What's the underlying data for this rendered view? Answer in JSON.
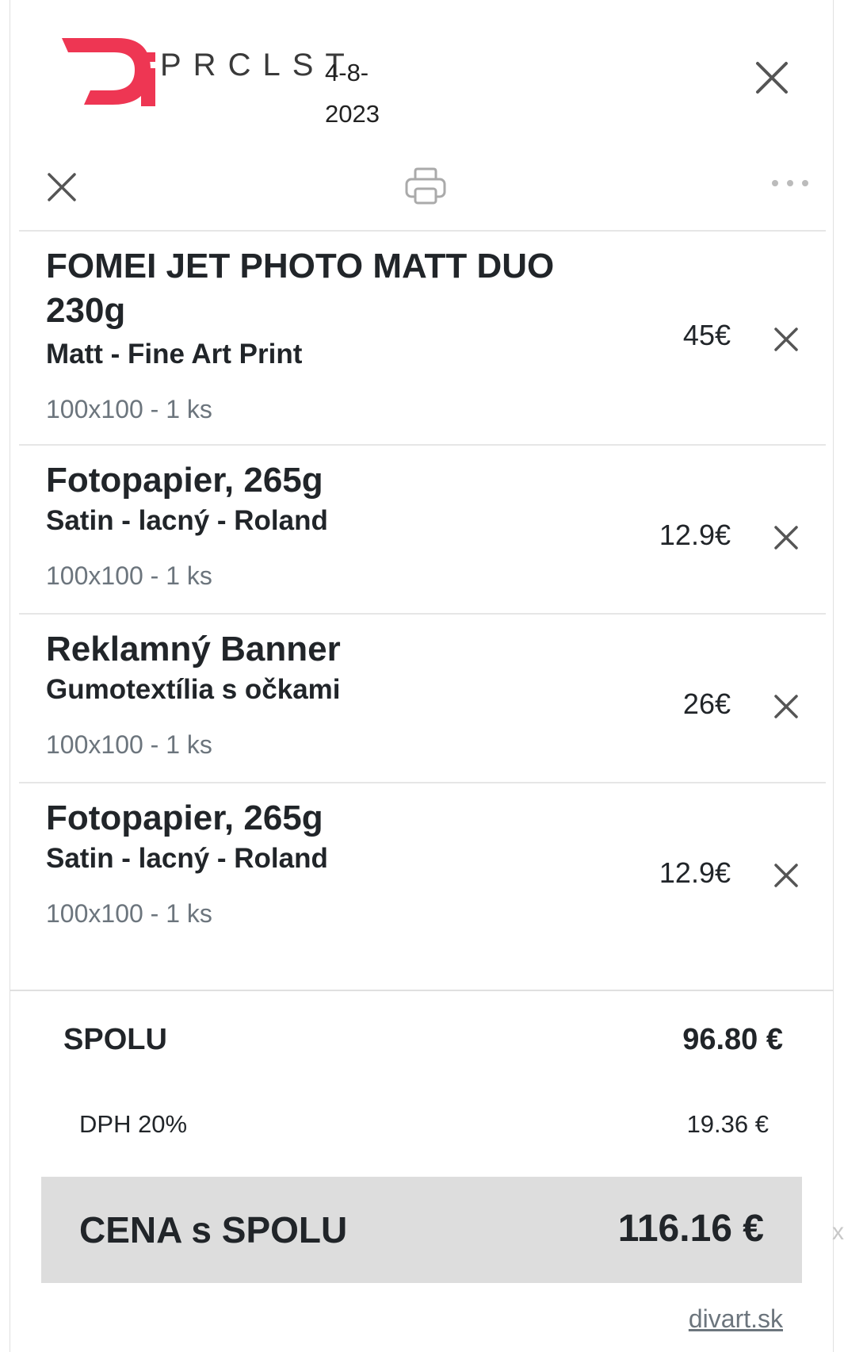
{
  "header": {
    "logo_text": "PRCLST",
    "date": "4-8-2023",
    "brand_color": "#ee3653"
  },
  "toolbar": {
    "close_icon": "close-icon",
    "print_icon": "printer-icon",
    "more_icon": "more-dots-icon"
  },
  "items": [
    {
      "name": "FOMEI JET PHOTO MATT DUO 230g",
      "variant": "Matt - Fine Art Print",
      "meta": "100x100 - 1 ks",
      "price": "45€"
    },
    {
      "name": "Fotopapier, 265g",
      "variant": "Satin - lacný - Roland",
      "meta": "100x100 - 1 ks",
      "price": "12.9€"
    },
    {
      "name": "Reklamný Banner",
      "variant": "Gumotextília s očkami",
      "meta": "100x100 - 1 ks",
      "price": "26€"
    },
    {
      "name": "Fotopapier, 265g",
      "variant": "Satin - lacný - Roland",
      "meta": "100x100 - 1 ks",
      "price": "12.9€"
    }
  ],
  "totals": {
    "sum_label": "SPOLU",
    "sum_value": "96.80 €",
    "vat_label": "DPH 20%",
    "vat_value": "19.36 €",
    "grand_label": "CENA s SPOLU",
    "grand_value": "116.16 €"
  },
  "footer": {
    "site_link": "divart.sk"
  },
  "edge_mark": "x"
}
